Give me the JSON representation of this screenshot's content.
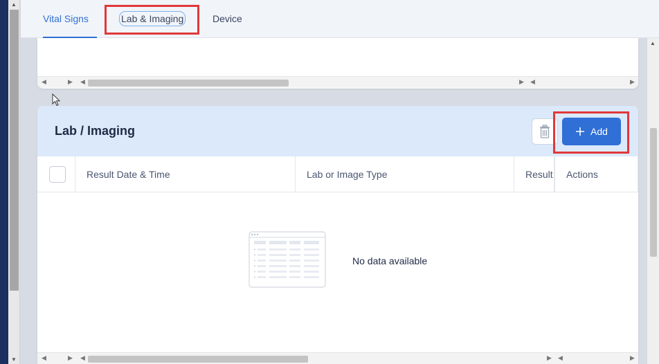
{
  "tabs": {
    "vital_signs": "Vital Signs",
    "lab_imaging": "Lab & Imaging",
    "device": "Device"
  },
  "lab_panel": {
    "title": "Lab / Imaging",
    "add_label": "Add",
    "columns": {
      "date": "Result Date & Time",
      "type": "Lab or Image Type",
      "result": "Result",
      "actions": "Actions"
    },
    "empty_text": "No data available"
  },
  "colors": {
    "accent": "#2f6fd6",
    "highlight": "#e1383a",
    "header_bg": "#dbe9fb"
  },
  "icons": [
    "trash-icon",
    "plus-icon",
    "empty-table-icon",
    "mouse-cursor-icon"
  ]
}
